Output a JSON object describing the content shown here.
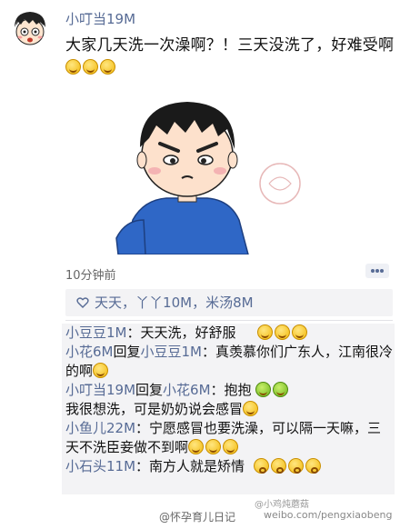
{
  "post": {
    "username": "小叮当19M",
    "text": "大家几天洗一次澡啊？！三天没洗了，好难受啊",
    "text_emojis": [
      "laugh",
      "laugh",
      "laugh"
    ],
    "time": "10分钟前",
    "likes": {
      "names": [
        "天天",
        "丫丫10M",
        "米汤8M"
      ]
    }
  },
  "comments": [
    {
      "author": "小豆豆1M",
      "reply_word": "",
      "reply_to": "",
      "text": "：天天洗，好舒服",
      "emojis": [
        "laugh",
        "laugh",
        "laugh"
      ]
    },
    {
      "author": "小花6M",
      "reply_word": "回复",
      "reply_to": "小豆豆1M",
      "text": "：真羡慕你们广东人，江南很冷的啊",
      "emojis": [
        "laugh"
      ]
    },
    {
      "author": "小叮当19M",
      "reply_word": "回复",
      "reply_to": "小花6M",
      "text": "：抱抱",
      "emojis": [
        "hug",
        "hug"
      ]
    },
    {
      "author": "",
      "reply_word": "",
      "reply_to": "",
      "text": "我很想洗，可是奶奶说会感冒",
      "emojis": [
        "laugh"
      ]
    },
    {
      "author": "小鱼儿22M",
      "reply_word": "",
      "reply_to": "",
      "text": "：宁愿感冒也要洗澡，可以隔一天嘛，三天不洗臣妾做不到啊",
      "emojis": [
        "laugh",
        "laugh",
        "laugh"
      ]
    },
    {
      "author": "小石头11M",
      "reply_word": "",
      "reply_to": "",
      "text": "：南方人就是矫情",
      "emojis": [
        "kiss",
        "kiss",
        "kiss",
        "kiss"
      ]
    }
  ],
  "watermarks": {
    "source": "@怀孕育儿日记",
    "weibo": "weibo.com/pengxiaobeng",
    "weibo_handle": "@小鸡炖蘑菇"
  },
  "colors": {
    "link": "#576b95",
    "comment_bg": "#f3f3f5",
    "emoji": "#f2b90a"
  }
}
